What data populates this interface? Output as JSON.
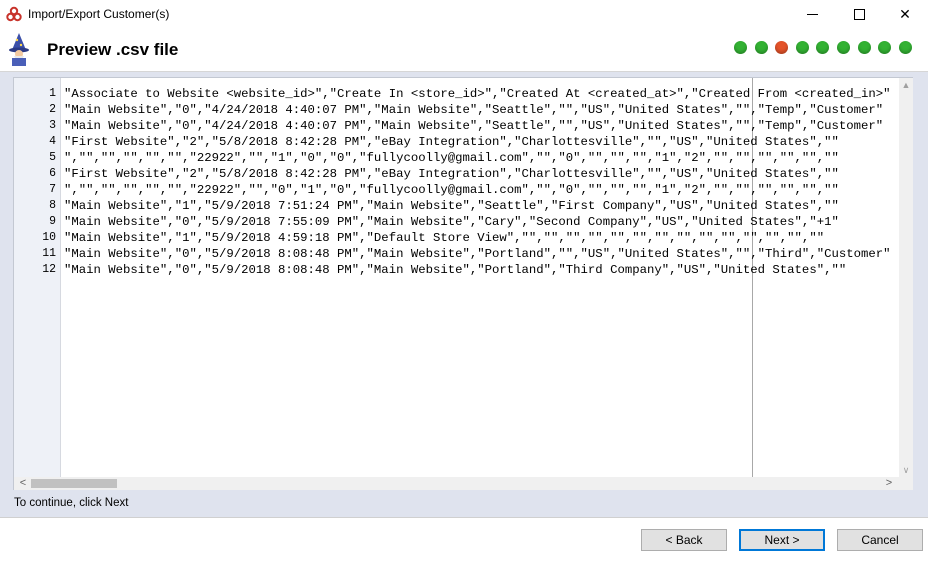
{
  "window": {
    "title": "Import/Export Customer(s)",
    "minimize_icon": "minimize-icon",
    "maximize_icon": "maximize-icon",
    "close_glyph": "✕"
  },
  "header": {
    "title": "Preview .csv file",
    "wizard_icon": "wizard-icon",
    "steps": [
      {
        "status": "done",
        "color": "#33b233"
      },
      {
        "status": "done",
        "color": "#33b233"
      },
      {
        "status": "current",
        "color": "#e4532a"
      },
      {
        "status": "pending",
        "color": "#33b233"
      },
      {
        "status": "pending",
        "color": "#33b233"
      },
      {
        "status": "pending",
        "color": "#33b233"
      },
      {
        "status": "pending",
        "color": "#33b233"
      },
      {
        "status": "pending",
        "color": "#33b233"
      },
      {
        "status": "pending",
        "color": "#33b233"
      }
    ]
  },
  "preview": {
    "lines": [
      {
        "no": "1",
        "text": "\"Associate to Website <website_id>\",\"Create In <store_id>\",\"Created At <created_at>\",\"Created From <created_in>\""
      },
      {
        "no": "2",
        "text": "\"Main Website\",\"0\",\"4/24/2018 4:40:07 PM\",\"Main Website\",\"Seattle\",\"\",\"US\",\"United States\",\"\",\"Temp\",\"Customer\""
      },
      {
        "no": "3",
        "text": "\"Main Website\",\"0\",\"4/24/2018 4:40:07 PM\",\"Main Website\",\"Seattle\",\"\",\"US\",\"United States\",\"\",\"Temp\",\"Customer\""
      },
      {
        "no": "4",
        "text": "\"First Website\",\"2\",\"5/8/2018 8:42:28 PM\",\"eBay Integration\",\"Charlottesville\",\"\",\"US\",\"United States\",\"\""
      },
      {
        "no": "5",
        "text": "\",\"\",\"\",\"\",\"\",\"\",\"22922\",\"\",\"1\",\"0\",\"0\",\"fullycoolly@gmail.com\",\"\",\"0\",\"\",\"\",\"\",\"1\",\"2\",\"\",\"\",\"\",\"\",\"\",\"\""
      },
      {
        "no": "6",
        "text": "\"First Website\",\"2\",\"5/8/2018 8:42:28 PM\",\"eBay Integration\",\"Charlottesville\",\"\",\"US\",\"United States\",\"\""
      },
      {
        "no": "7",
        "text": "\",\"\",\"\",\"\",\"\",\"\",\"22922\",\"\",\"0\",\"1\",\"0\",\"fullycoolly@gmail.com\",\"\",\"0\",\"\",\"\",\"\",\"1\",\"2\",\"\",\"\",\"\",\"\",\"\",\"\""
      },
      {
        "no": "8",
        "text": "\"Main Website\",\"1\",\"5/9/2018 7:51:24 PM\",\"Main Website\",\"Seattle\",\"First Company\",\"US\",\"United States\",\"\""
      },
      {
        "no": "9",
        "text": "\"Main Website\",\"0\",\"5/9/2018 7:55:09 PM\",\"Main Website\",\"Cary\",\"Second Company\",\"US\",\"United States\",\"+1\""
      },
      {
        "no": "10",
        "text": "\"Main Website\",\"1\",\"5/9/2018 4:59:18 PM\",\"Default Store View\",\"\",\"\",\"\",\"\",\"\",\"\",\"\",\"\",\"\",\"\",\"\",\"\",\"\",\"\""
      },
      {
        "no": "11",
        "text": "\"Main Website\",\"0\",\"5/9/2018 8:08:48 PM\",\"Main Website\",\"Portland\",\"\",\"US\",\"United States\",\"\",\"Third\",\"Customer\""
      },
      {
        "no": "12",
        "text": "\"Main Website\",\"0\",\"5/9/2018 8:08:48 PM\",\"Main Website\",\"Portland\",\"Third Company\",\"US\",\"United States\",\"\""
      }
    ],
    "scroll_left_glyph": "<",
    "scroll_right_glyph": ">",
    "scroll_up_glyph": "▲",
    "scroll_down_glyph": "∨"
  },
  "status": "To continue, click Next",
  "buttons": {
    "back": "< Back",
    "next": "Next >",
    "cancel": "Cancel"
  }
}
